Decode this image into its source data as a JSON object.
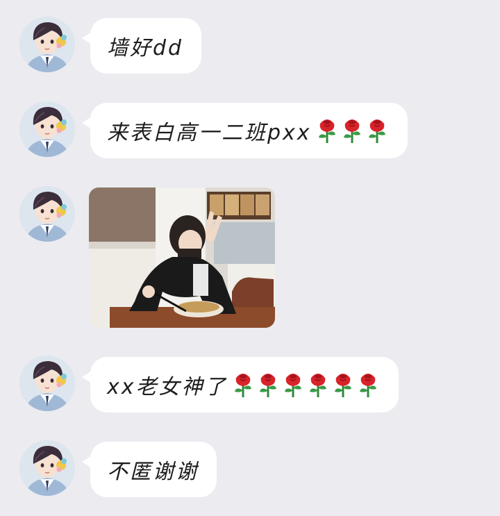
{
  "colors": {
    "background": "#ebebf0",
    "bubble": "#ffffff",
    "text": "#1d1d1d",
    "rose_red": "#d8232a",
    "rose_stem": "#2f8a3a"
  },
  "messages": [
    {
      "type": "text",
      "text": "墙好dd",
      "roses": 0,
      "avatar_icon": "anime-boy-avatar-icon"
    },
    {
      "type": "text",
      "text": "来表白高一二班pxx",
      "roses": 3,
      "avatar_icon": "anime-boy-avatar-icon"
    },
    {
      "type": "image",
      "image_desc": "photo-girl-eating-noodles",
      "avatar_icon": "anime-boy-avatar-icon"
    },
    {
      "type": "text",
      "text": "xx老女神了",
      "roses": 6,
      "avatar_icon": "anime-boy-avatar-icon"
    },
    {
      "type": "text",
      "text": "不匿谢谢",
      "roses": 0,
      "avatar_icon": "anime-boy-avatar-icon"
    }
  ]
}
